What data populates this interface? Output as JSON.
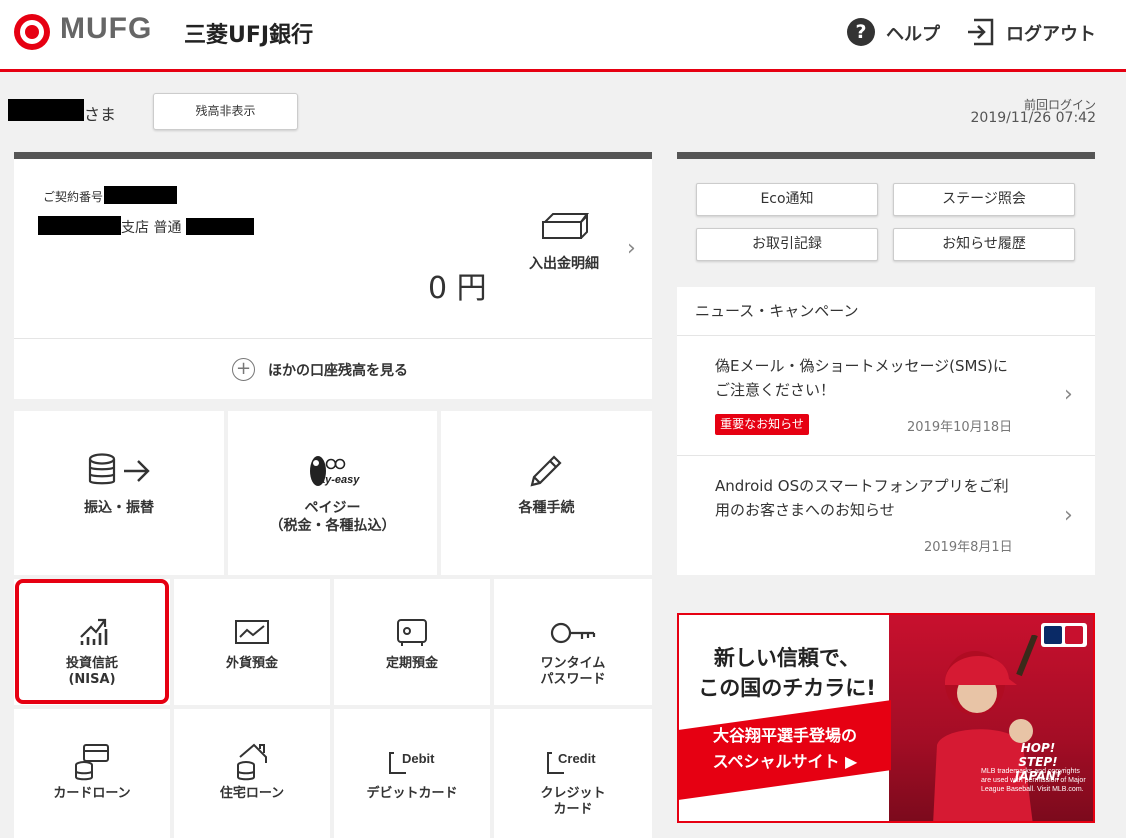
{
  "header": {
    "logo_text": "MUFG",
    "bank_name": "三菱UFJ銀行",
    "help_label": "ヘルプ",
    "logout_label": "ログアウト"
  },
  "customer": {
    "honorific": "さま",
    "hide_balance_button": "残高非表示",
    "last_login_label": "前回ログイン",
    "last_login_date": "2019/11/26 07:42"
  },
  "account": {
    "contract_number_label": "ご契約番号",
    "branch_suffix": "支店 普通",
    "balance": "0 円",
    "statement_label": "入出金明細",
    "other_accounts_label": "ほかの口座残高を見る"
  },
  "main_tiles": [
    {
      "label": "振込・振替",
      "icon": "coins-arrow-icon"
    },
    {
      "label_line1": "ペイジー",
      "label_line2": "（税金・各種払込）",
      "icon": "payeasy-logo"
    },
    {
      "label": "各種手続",
      "icon": "pencil-icon"
    }
  ],
  "payeasy_logo_text": "ay-easy",
  "sub_tiles_row1": [
    {
      "line1": "投資信託",
      "line2": "(NISA)",
      "icon": "growth-chart-icon"
    },
    {
      "line1": "外貨預金",
      "line2": "",
      "icon": "chart-screen-icon"
    },
    {
      "line1": "定期預金",
      "line2": "",
      "icon": "safe-icon"
    },
    {
      "line1": "ワンタイム",
      "line2": "パスワード",
      "icon": "key-icon"
    }
  ],
  "sub_tiles_row2": [
    {
      "line1": "カードローン",
      "line2": "",
      "icon": "card-loan-icon"
    },
    {
      "line1": "住宅ローン",
      "line2": "",
      "icon": "house-loan-icon"
    },
    {
      "line1": "デビットカード",
      "line2": "",
      "icon": "debit-card-icon",
      "icon_text": "Debit"
    },
    {
      "line1": "クレジット",
      "line2": "カード",
      "icon": "credit-card-icon",
      "icon_text": "Credit"
    }
  ],
  "quick_buttons": [
    "Eco通知",
    "ステージ照会",
    "お取引記録",
    "お知らせ履歴"
  ],
  "news": {
    "title": "ニュース・キャンペーン",
    "items": [
      {
        "line1": "偽Eメール・偽ショートメッセージ(SMS)に",
        "line2": "ご注意ください！",
        "badge": "重要なお知らせ",
        "date": "2019年10月18日"
      },
      {
        "line1": "Android OSのスマートフォンアプリをご利",
        "line2": "用のお客さまへのお知らせ",
        "date": "2019年8月1日"
      }
    ]
  },
  "banner": {
    "headline_line1": "新しい信頼で、",
    "headline_line2": "この国のチカラに!",
    "sub_line1": "大谷翔平選手登場の",
    "sub_line2": "スペシャルサイト ▶",
    "hop_line1": "HOP!",
    "hop_line2": "STEP!",
    "hop_line3": "JAPAN!",
    "fine_print": "MLB trademarks and copyrights are used with permission of Major League Baseball. Visit MLB.com."
  },
  "colors": {
    "brand_red": "#e60012",
    "dark_bar": "#555555",
    "background": "#f1f1f1"
  }
}
